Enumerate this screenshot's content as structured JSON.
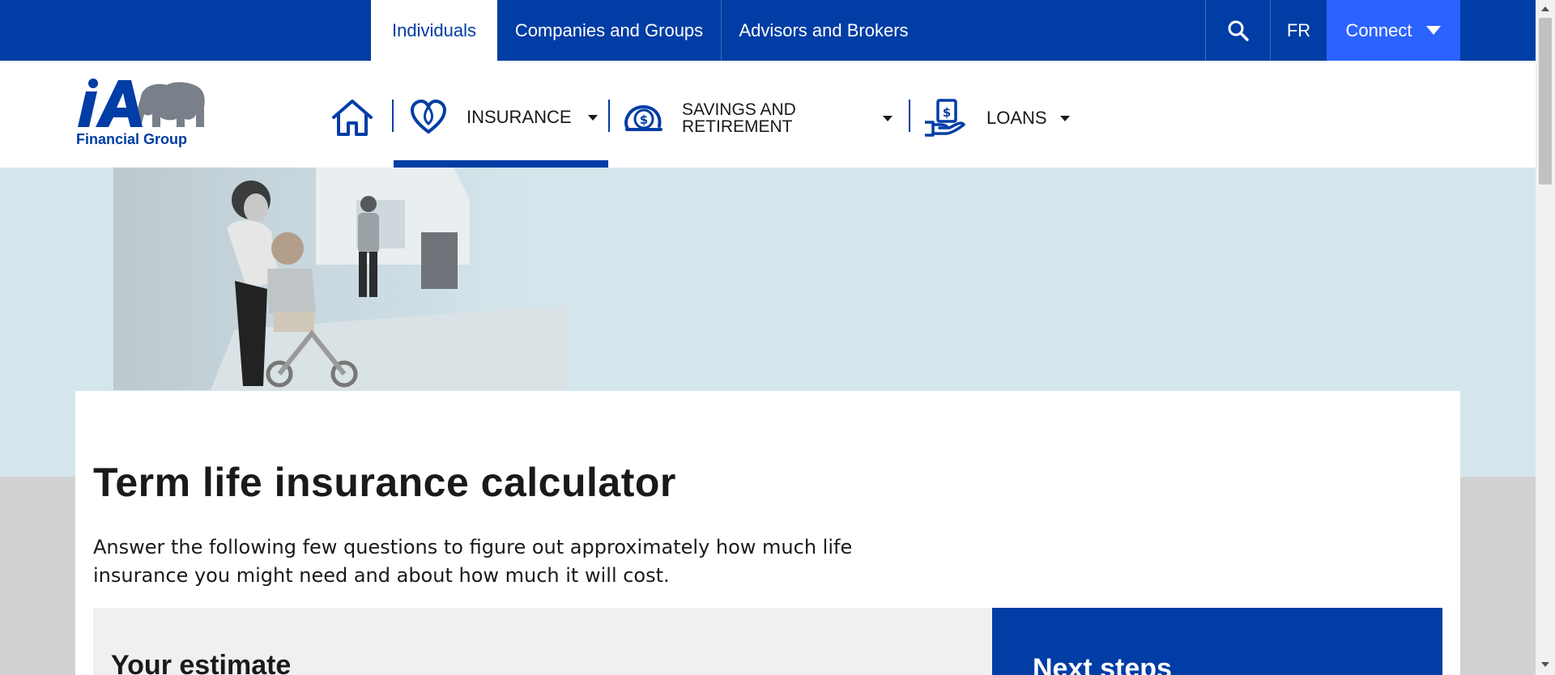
{
  "topbar": {
    "tabs": [
      {
        "label": "Individuals",
        "active": true
      },
      {
        "label": "Companies and Groups",
        "active": false
      },
      {
        "label": "Advisors and Brokers",
        "active": false
      }
    ],
    "search_icon": "search-icon",
    "language_label": "FR",
    "connect_label": "Connect"
  },
  "logo": {
    "brand": "iA",
    "subtitle": "Financial Group"
  },
  "nav": {
    "items": [
      {
        "label": "",
        "icon": "home-icon"
      },
      {
        "label": "INSURANCE",
        "icon": "heart-icon",
        "active": true
      },
      {
        "label": "SAVINGS AND RETIREMENT",
        "icon": "piggy-bank-icon"
      },
      {
        "label": "LOANS",
        "icon": "hand-money-icon"
      }
    ]
  },
  "main": {
    "title": "Term life insurance calculator",
    "intro": "Answer the following few questions to figure out approximately how much life insurance you might need and about how much it will cost.",
    "estimate_title": "Your estimate",
    "next_steps_title": "Next steps"
  },
  "colors": {
    "brand_blue": "#003da5",
    "connect_blue": "#2b63ff",
    "hero_bg": "#d4e6ec",
    "page_bg": "#d1d1d1"
  }
}
